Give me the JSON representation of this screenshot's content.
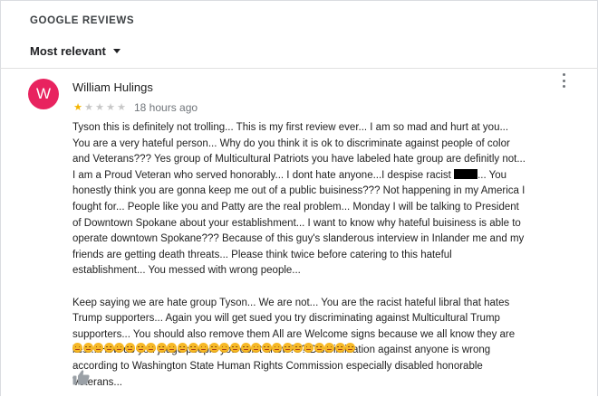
{
  "section": {
    "title": "GOOGLE REVIEWS"
  },
  "sort": {
    "label": "Most relevant",
    "icon": "caret-down-icon"
  },
  "review": {
    "avatar_letter": "W",
    "avatar_color": "#e8235f",
    "author": "William Hulings",
    "rating": 1,
    "rating_max": 5,
    "time": "18 hours ago",
    "p1_a": "Tyson this is definitely not trolling... This is my first review ever... I am so mad and hurt at you... You are a very hateful person... Why do you think it is ok to discriminate against people of color and Veterans??? Yes group of Multicultural Patriots you have labeled hate group are definitly not... I am a Proud Veteran who served honorably... I dont hate anyone...I despise racist ",
    "p1_b": "... You honestly think you are gonna keep me out of a public buisiness??? Not happening in my America I fought for... People like you and Patty are the real problem... Monday I will be talking to President of Downtown Spokane about your establishment... I want to know why hateful buisiness is able to operate downtown Spokane??? Because of this guy's slanderous interview in Inlander me and my friends are getting death threats... Please think twice before catering to this hateful establishment... You messed with wrong people...",
    "p2": "Keep saying we are hate group Tyson... We are not... You are the racist hateful libral that hates Trump supporters... Again you will get sued you try discriminating against Multicultural Trump supporters... You should also remove them All are Welcome signs because we all know they are lies... How do you judge people you don't know??? Discrimination against anyone is wrong according to Washington State Human Rights Commission especially disabled honorable Veterans...",
    "emoji_count": 27,
    "emoji_icon": "angry-face-emoji-icon"
  },
  "colors": {
    "star_on": "#f4b400",
    "star_off": "#c8c8c8",
    "muted": "#70757a"
  }
}
